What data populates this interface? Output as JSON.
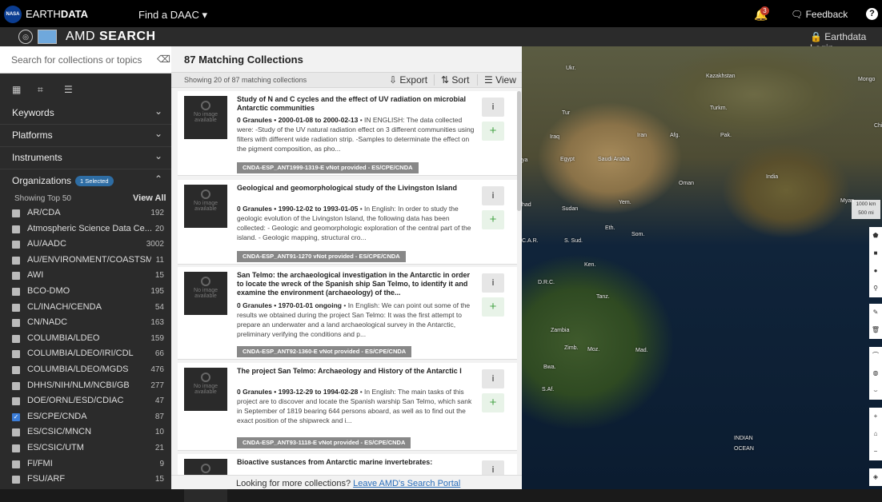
{
  "topbar": {
    "nasa_badge": "NASA",
    "brand_light": "EARTH",
    "brand_bold": "DATA",
    "find_daac": "Find a DAAC ▾",
    "notification_count": "3",
    "feedback": "Feedback",
    "help": "?"
  },
  "subbar": {
    "app_light": "AMD",
    "app_bold": "SEARCH",
    "login": "Earthdata Login"
  },
  "sidebar": {
    "search_placeholder": "Search for collections or topics",
    "facets": [
      "Keywords",
      "Platforms",
      "Instruments"
    ],
    "organizations_label": "Organizations",
    "selected_badge": "1 Selected",
    "showing_top": "Showing Top 50",
    "view_all": "View All",
    "organizations": [
      {
        "name": "AR/CDA",
        "count": "192",
        "checked": false
      },
      {
        "name": "Atmospheric Science Data Ce...",
        "count": "20",
        "checked": false
      },
      {
        "name": "AU/AADC",
        "count": "3002",
        "checked": false
      },
      {
        "name": "AU/ENVIRONMENT/COASTSMA...",
        "count": "11",
        "checked": false
      },
      {
        "name": "AWI",
        "count": "15",
        "checked": false
      },
      {
        "name": "BCO-DMO",
        "count": "195",
        "checked": false
      },
      {
        "name": "CL/INACH/CENDA",
        "count": "54",
        "checked": false
      },
      {
        "name": "CN/NADC",
        "count": "163",
        "checked": false
      },
      {
        "name": "COLUMBIA/LDEO",
        "count": "159",
        "checked": false
      },
      {
        "name": "COLUMBIA/LDEO/IRI/CDL",
        "count": "66",
        "checked": false
      },
      {
        "name": "COLUMBIA/LDEO/MGDS",
        "count": "476",
        "checked": false
      },
      {
        "name": "DHHS/NIH/NLM/NCBI/GB",
        "count": "277",
        "checked": false
      },
      {
        "name": "DOE/ORNL/ESD/CDIAC",
        "count": "47",
        "checked": false
      },
      {
        "name": "ES/CPE/CNDA",
        "count": "87",
        "checked": true
      },
      {
        "name": "ES/CSIC/MNCN",
        "count": "10",
        "checked": false
      },
      {
        "name": "ES/CSIC/UTM",
        "count": "21",
        "checked": false
      },
      {
        "name": "FI/FMI",
        "count": "9",
        "checked": false
      },
      {
        "name": "FSU/ARF",
        "count": "15",
        "checked": false
      }
    ]
  },
  "results": {
    "title": "87 Matching Collections",
    "showing": "Showing 20 of 87 matching collections",
    "export": "Export",
    "sort": "Sort",
    "view": "View",
    "no_image": "No image available",
    "cards": [
      {
        "title": "Study of N and C cycles and the effect of UV radiation on microbial Antarctic communities",
        "meta": "0 Granules • 2000-01-08 to 2000-02-13",
        "desc": " • IN ENGLISH: The data collected were: -Study of the UV natural radiation effect on 3 different communities using filters with different wide radiation strip. -Samples to determinate the effect on the pigment composition, as pho...",
        "tag": "CNDA-ESP_ANT1999-1319-E vNot provided - ES/CPE/CNDA"
      },
      {
        "title": "Geological and geomorphological study of the Livingston Island",
        "meta": "0 Granules • 1990-12-02 to 1993-01-05",
        "desc": " • In English: In order to study the geologic evolution of the Livingston Island, the following data has been collected: - Geologic and geomorphologic exploration of the central part of the island. - Geologic mapping, structural cro...",
        "tag": "CNDA-ESP_ANT91-1270 vNot provided - ES/CPE/CNDA"
      },
      {
        "title": "San Telmo: the archaeological investigation in the Antarctic in order to locate the wreck of the Spanish ship San Telmo, to identify it and examine the environment (archaeology) of the...",
        "meta": "0 Granules • 1970-01-01 ongoing",
        "desc": " • In English: We can point out some of the results we obtained during the project San Telmo: It was the first attempt to prepare an underwater and a land archaeological survey in the Antarctic, preliminary verifying the conditions and p...",
        "tag": "CNDA-ESP_ANT92-1360-E vNot provided - ES/CPE/CNDA"
      },
      {
        "title": "The project San Telmo: Archaeology and History of the Antarctic I",
        "meta": "0 Granules • 1993-12-29 to 1994-02-28",
        "desc": " • In English: The main tasks of this project are to discover and locate the Spanish warship San Telmo, which sank in September of 1819 bearing 644 persons aboard, as well as to find out the exact position of the shipwreck and i...",
        "tag": "CNDA-ESP_ANT93-1118-E vNot provided - ES/CPE/CNDA"
      },
      {
        "title": "Bioactive sustances from Antarctic marine invertebrates:",
        "meta": "",
        "desc": "",
        "tag": ""
      }
    ],
    "footer_text": "Looking for more collections? ",
    "footer_link": "Leave AMD's Search Portal"
  },
  "map": {
    "labels": [
      "Ukr.",
      "Kazakhstan",
      "Mongo",
      "Turkm.",
      "Iraq",
      "Iran",
      "Afg.",
      "Pak.",
      "Egypt",
      "Saudi Arabia",
      "India",
      "Oman",
      "Yem.",
      "Sudan",
      "Eth.",
      "Som.",
      "C.A.R.",
      "S. Sud.",
      "Ken.",
      "D.R.C.",
      "Tanz.",
      "Zambia",
      "Zimb.",
      "Moz.",
      "Mad.",
      "Bwa.",
      "S.Af.",
      "INDIAN",
      "OCEAN",
      "Myan",
      "Chi",
      "had",
      "ya",
      "Ma",
      "Tur"
    ],
    "scale_km": "1000 km",
    "scale_mi": "500 mi"
  }
}
